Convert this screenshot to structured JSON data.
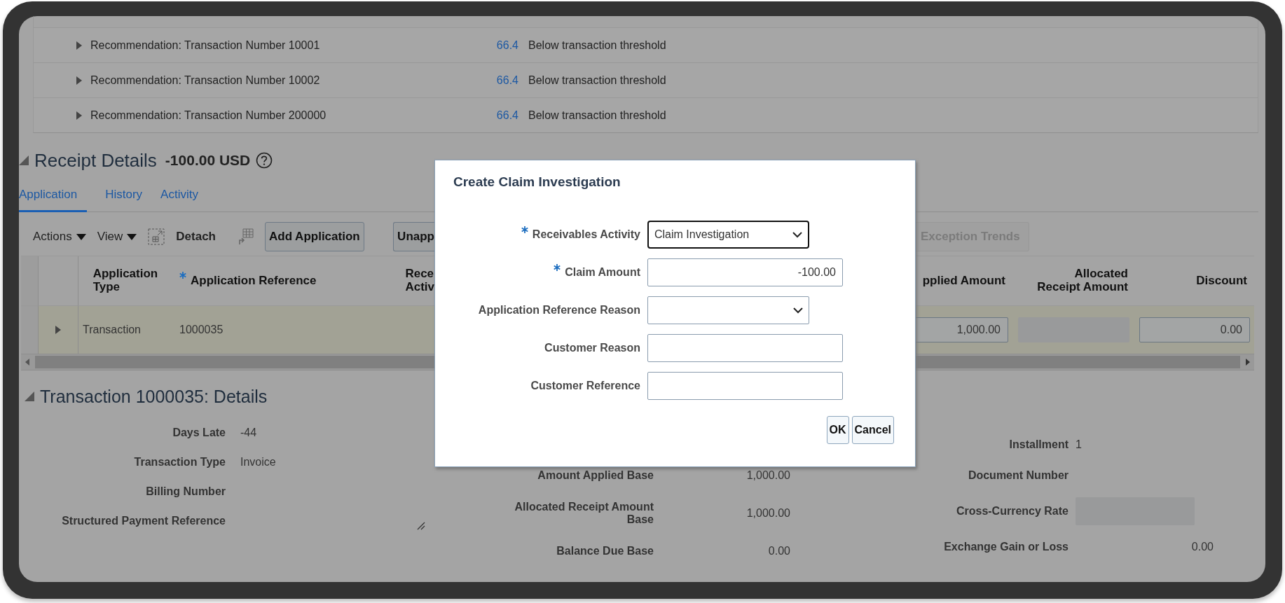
{
  "recommendations": [
    {
      "label": "Recommendation: Transaction Number 10001",
      "score": "66.4",
      "reason": "Below transaction threshold",
      "expanded": false
    },
    {
      "label": "Recommendation: Transaction Number 10002",
      "score": "66.4",
      "reason": "Below transaction threshold",
      "expanded": false
    },
    {
      "label": "Recommendation: Transaction Number 200000",
      "score": "66.4",
      "reason": "Below transaction threshold",
      "expanded": false
    }
  ],
  "receipt_details": {
    "title": "Receipt Details",
    "amount": "-100.00 USD",
    "expanded": true,
    "tabs": [
      {
        "label": "Application",
        "selected": true
      },
      {
        "label": "History",
        "selected": false
      },
      {
        "label": "Activity",
        "selected": false
      }
    ],
    "toolbar": {
      "menus": [
        "Actions",
        "View"
      ],
      "detach": "Detach",
      "buttons": [
        {
          "label": "Add Application",
          "disabled": false
        },
        {
          "label": "Unapp",
          "disabled": false
        }
      ],
      "right_button": {
        "label": "Exception Trends",
        "disabled": true
      }
    },
    "table": {
      "columns": [
        {
          "label": "Application Type",
          "required": false
        },
        {
          "label": "Application Reference",
          "required": true
        },
        {
          "label": "Rece Activ",
          "required": false
        },
        {
          "label": "pplied Amount",
          "required": false
        },
        {
          "label": "Allocated Receipt Amount",
          "required": false
        },
        {
          "label": "Discount",
          "required": false
        }
      ],
      "rows": [
        {
          "selected": true,
          "expanded": false,
          "application_type": "Transaction",
          "application_reference": "1000035",
          "applied_amount": "1,000.00",
          "discount": "0.00"
        }
      ]
    }
  },
  "transaction_details": {
    "title": "Transaction 1000035: Details",
    "expanded": true,
    "left": [
      {
        "label": "Days Late",
        "value": "-44",
        "kind": "text"
      },
      {
        "label": "Transaction Type",
        "value": "Invoice",
        "kind": "text"
      },
      {
        "label": "Billing Number",
        "kind": "text"
      },
      {
        "label": "Structured Payment Reference",
        "kind": "textarea"
      }
    ],
    "middle": [
      {
        "label": "Amount Applied Base",
        "value": "1,000.00",
        "kind": "amount"
      },
      {
        "label": "Allocated Receipt Amount Base",
        "value": "1,000.00",
        "kind": "amount"
      },
      {
        "label": "Balance Due Base",
        "value": "0.00",
        "kind": "amount"
      }
    ],
    "right": [
      {
        "label": "Installment",
        "value": "1",
        "kind": "text"
      },
      {
        "label": "Document Number",
        "kind": "text"
      },
      {
        "label": "Cross-Currency Rate",
        "kind": "field"
      },
      {
        "label": "Exchange Gain or Loss",
        "value": "0.00",
        "kind": "amount"
      }
    ]
  },
  "dialog": {
    "title": "Create Claim Investigation",
    "fields": [
      {
        "label": "Receivables Activity",
        "required": true,
        "kind": "select",
        "value": "Claim Investigation",
        "focused": true
      },
      {
        "label": "Claim Amount",
        "required": true,
        "kind": "number",
        "value": "-100.00",
        "focused": false
      },
      {
        "label": "Application Reference Reason",
        "required": false,
        "kind": "select",
        "focused": false
      },
      {
        "label": "Customer Reason",
        "required": false,
        "kind": "text",
        "focused": false
      },
      {
        "label": "Customer Reference",
        "required": false,
        "kind": "text",
        "focused": false
      }
    ],
    "buttons": [
      "OK",
      "Cancel"
    ]
  }
}
